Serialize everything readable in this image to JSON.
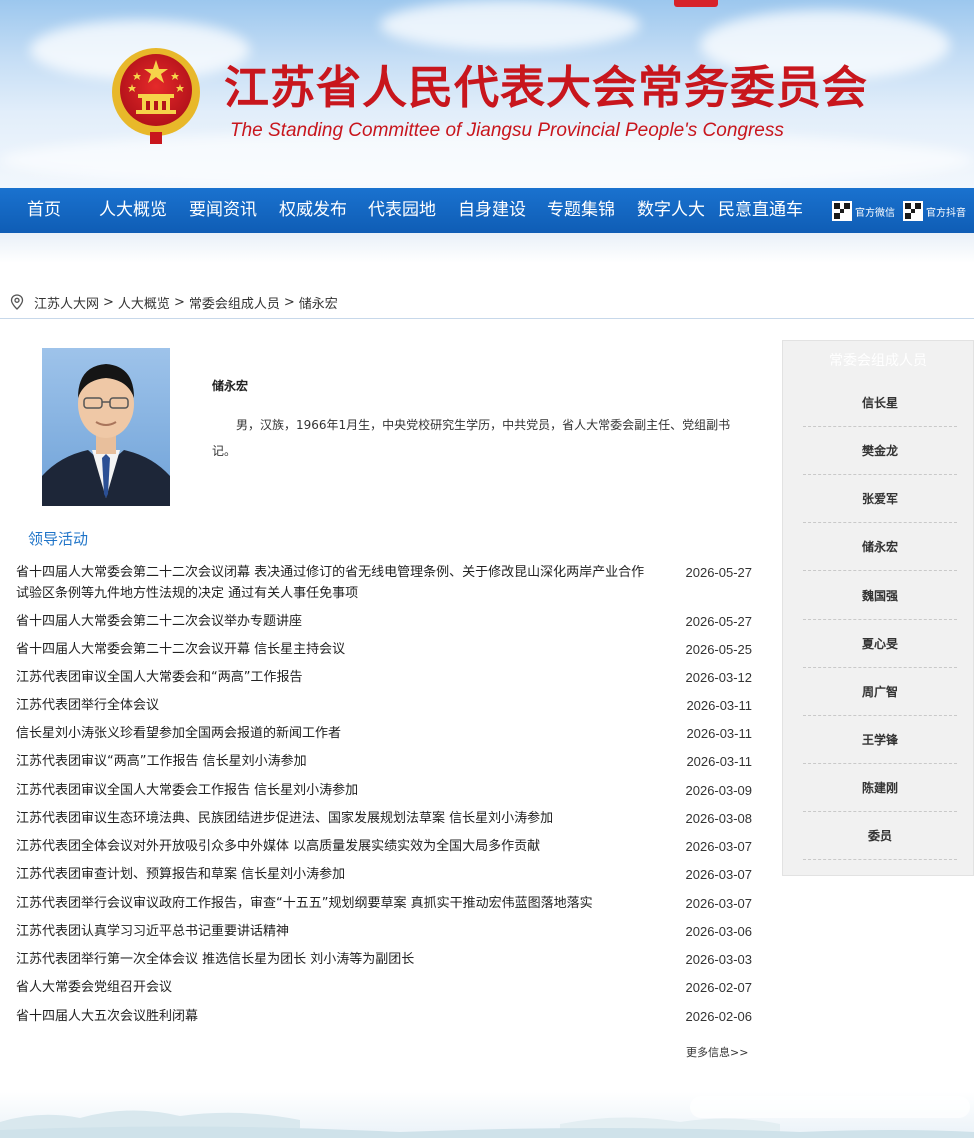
{
  "header": {
    "title_cn": "江苏省人民代表大会常务委员会",
    "title_en": "The Standing Committee of Jiangsu Provincial People's Congress",
    "brand_red": "#c8161d",
    "emblem_icon": "national-emblem-icon"
  },
  "nav": {
    "items": [
      {
        "label": "首页"
      },
      {
        "label": "人大概览"
      },
      {
        "label": "要闻资讯"
      },
      {
        "label": "权威发布"
      },
      {
        "label": "代表园地"
      },
      {
        "label": "自身建设"
      },
      {
        "label": "专题集锦"
      },
      {
        "label": "数字人大"
      },
      {
        "label": "民意直通车"
      }
    ],
    "social": [
      {
        "label": "官方微信",
        "icon": "qr-code-icon"
      },
      {
        "label": "官方抖音",
        "icon": "qr-code-icon"
      }
    ],
    "bar_color": "#1468c4"
  },
  "breadcrumb": {
    "icon": "location-pin-icon",
    "items": [
      "江苏人大网",
      "人大概览",
      "常委会组成人员",
      "储永宏"
    ],
    "separator": ">"
  },
  "profile": {
    "name": "储永宏",
    "bio": "男，汉族，1966年1月生，中央党校研究生学历，中共党员，省人大常委会副主任、党组副书记。"
  },
  "activities": {
    "title": "领导活动",
    "items": [
      {
        "title": "省十四届人大常委会第二十二次会议闭幕 表决通过修订的省无线电管理条例、关于修改昆山深化两岸产业合作试验区条例等九件地方性法规的决定 通过有关人事任免事项",
        "date": "2026-05-27"
      },
      {
        "title": "省十四届人大常委会第二十二次会议举办专题讲座",
        "date": "2026-05-27"
      },
      {
        "title": "省十四届人大常委会第二十二次会议开幕 信长星主持会议",
        "date": "2026-05-25"
      },
      {
        "title": "江苏代表团审议全国人大常委会和“两高”工作报告",
        "date": "2026-03-12"
      },
      {
        "title": "江苏代表团举行全体会议",
        "date": "2026-03-11"
      },
      {
        "title": "信长星刘小涛张义珍看望参加全国两会报道的新闻工作者",
        "date": "2026-03-11"
      },
      {
        "title": "江苏代表团审议“两高”工作报告 信长星刘小涛参加",
        "date": "2026-03-11"
      },
      {
        "title": "江苏代表团审议全国人大常委会工作报告 信长星刘小涛参加",
        "date": "2026-03-09"
      },
      {
        "title": "江苏代表团审议生态环境法典、民族团结进步促进法、国家发展规划法草案 信长星刘小涛参加",
        "date": "2026-03-08"
      },
      {
        "title": "江苏代表团全体会议对外开放吸引众多中外媒体 以高质量发展实绩实效为全国大局多作贡献",
        "date": "2026-03-07"
      },
      {
        "title": "江苏代表团审查计划、预算报告和草案 信长星刘小涛参加",
        "date": "2026-03-07"
      },
      {
        "title": "江苏代表团举行会议审议政府工作报告，审查“十五五”规划纲要草案 真抓实干推动宏伟蓝图落地落实",
        "date": "2026-03-07"
      },
      {
        "title": "江苏代表团认真学习习近平总书记重要讲话精神",
        "date": "2026-03-06"
      },
      {
        "title": "江苏代表团举行第一次全体会议 推选信长星为团长 刘小涛等为副团长",
        "date": "2026-03-03"
      },
      {
        "title": "省人大常委会党组召开会议",
        "date": "2026-02-07"
      },
      {
        "title": "省十四届人大五次会议胜利闭幕",
        "date": "2026-02-06"
      }
    ],
    "more": "更多信息>>",
    "title_color": "#1f74c8"
  },
  "sidebar": {
    "title": "常委会组成人员",
    "items": [
      {
        "label": "信长星"
      },
      {
        "label": "樊金龙"
      },
      {
        "label": "张爱军"
      },
      {
        "label": "储永宏"
      },
      {
        "label": "魏国强"
      },
      {
        "label": "夏心旻"
      },
      {
        "label": "周广智"
      },
      {
        "label": "王学锋"
      },
      {
        "label": "陈建刚"
      },
      {
        "label": "委员"
      }
    ]
  }
}
